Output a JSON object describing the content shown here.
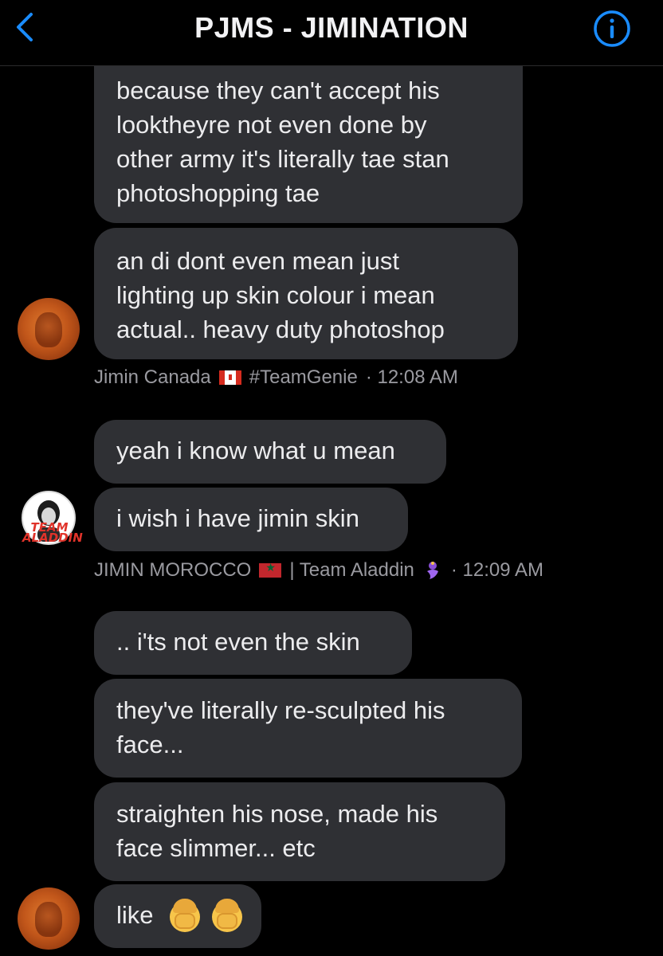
{
  "header": {
    "title": "PJMS - JIMINATION",
    "back_icon": "chevron-left-icon",
    "info_icon": "info-icon",
    "accent_color": "#1a8cff"
  },
  "messages": [
    {
      "text": "because they can't accept his\nlooktheyre not even done by\nother army it's literally tae stan\nphotoshopping tae"
    },
    {
      "text": "an di dont even mean just\nlighting up skin colour i mean\nactual..  heavy duty photoshop"
    },
    {
      "text": "yeah i know what u mean"
    },
    {
      "text": "i wish i have jimin skin"
    },
    {
      "text": ".. i'ts not even the skin"
    },
    {
      "text": "they've literally re-sculpted his\nface..."
    },
    {
      "text": "straighten his nose, made his\nface slimmer... etc"
    },
    {
      "text": "like"
    }
  ],
  "meta": [
    {
      "name": "Jimin Canada",
      "tag": "#TeamGenie",
      "time": "· 12:08 AM"
    },
    {
      "name": "JIMIN MOROCCO",
      "tag": "| Team Aladdin",
      "time": "· 12:09 AM"
    }
  ],
  "avatar_text": {
    "line1": "TEAM",
    "line2": "ALADDIN"
  }
}
